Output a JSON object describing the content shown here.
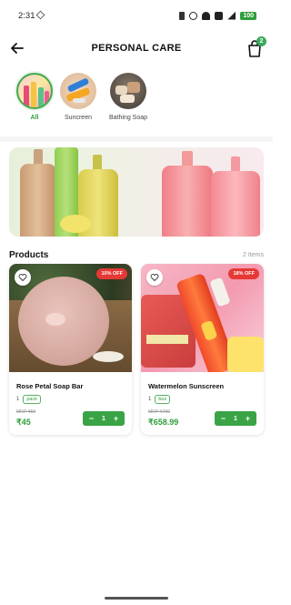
{
  "status_bar": {
    "time": "2:31",
    "battery": "100"
  },
  "header": {
    "title": "PERSONAL CARE",
    "cart_count": "2"
  },
  "categories": [
    {
      "label": "All",
      "active": true
    },
    {
      "label": "Suncreen",
      "active": false
    },
    {
      "label": "Bathing Soap",
      "active": false
    }
  ],
  "products_section": {
    "title": "Products",
    "count": "2 Items"
  },
  "products": [
    {
      "name": "Rose Petal Soap Bar",
      "qty": "1",
      "unit": "pack",
      "mrp": "MRP ₹50",
      "price": "₹45",
      "discount": "10% OFF",
      "quantity": "1"
    },
    {
      "name": "Watermelon Sunscreen",
      "qty": "1",
      "unit": "bus",
      "mrp": "MRP ₹799",
      "price": "₹658.99",
      "discount": "18% OFF",
      "quantity": "1"
    }
  ],
  "colors": {
    "accent": "#3aa346",
    "discount": "#e53935"
  }
}
